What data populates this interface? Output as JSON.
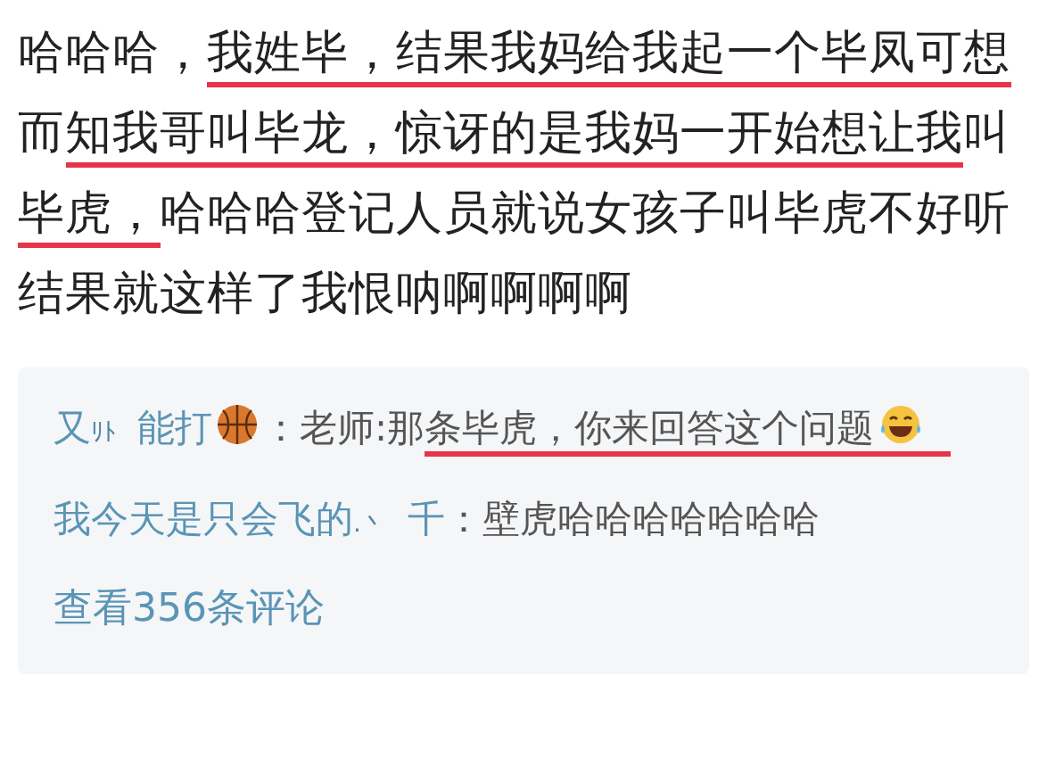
{
  "post": {
    "segments": [
      {
        "text": "哈哈哈，",
        "underlined": false
      },
      {
        "text": "我姓毕，结果我妈给我起一个毕凤可想",
        "underlined": true
      },
      {
        "text": "而",
        "underlined": false
      },
      {
        "text": "知我哥叫毕龙，惊讶的是我妈一开始想让我",
        "underlined": true
      },
      {
        "text": "叫",
        "underlined": false
      },
      {
        "text": "毕虎，",
        "underlined": true
      },
      {
        "text": "哈哈哈登记人员就说女孩子叫毕虎不好听结果就这样了我恨呐啊啊啊啊",
        "underlined": false
      }
    ]
  },
  "replies": [
    {
      "user": "又",
      "user_suffix": "ﾘﾄ",
      "user_tail": "能打",
      "user_badge": true,
      "segments": [
        {
          "kind": "text",
          "text": "：老师:那",
          "underlined": false
        },
        {
          "kind": "text",
          "text": "条毕虎，你来回答这个问题",
          "underlined": true
        },
        {
          "kind": "laugh",
          "underlined": true
        }
      ]
    },
    {
      "user": "我今天是只会飞的",
      "user_suffix": ".丶",
      "user_tail": "千",
      "user_badge": false,
      "segments": [
        {
          "kind": "text",
          "text": "：壁虎哈哈哈哈哈哈哈",
          "underlined": false
        }
      ]
    }
  ],
  "more_link": "查看356条评论"
}
